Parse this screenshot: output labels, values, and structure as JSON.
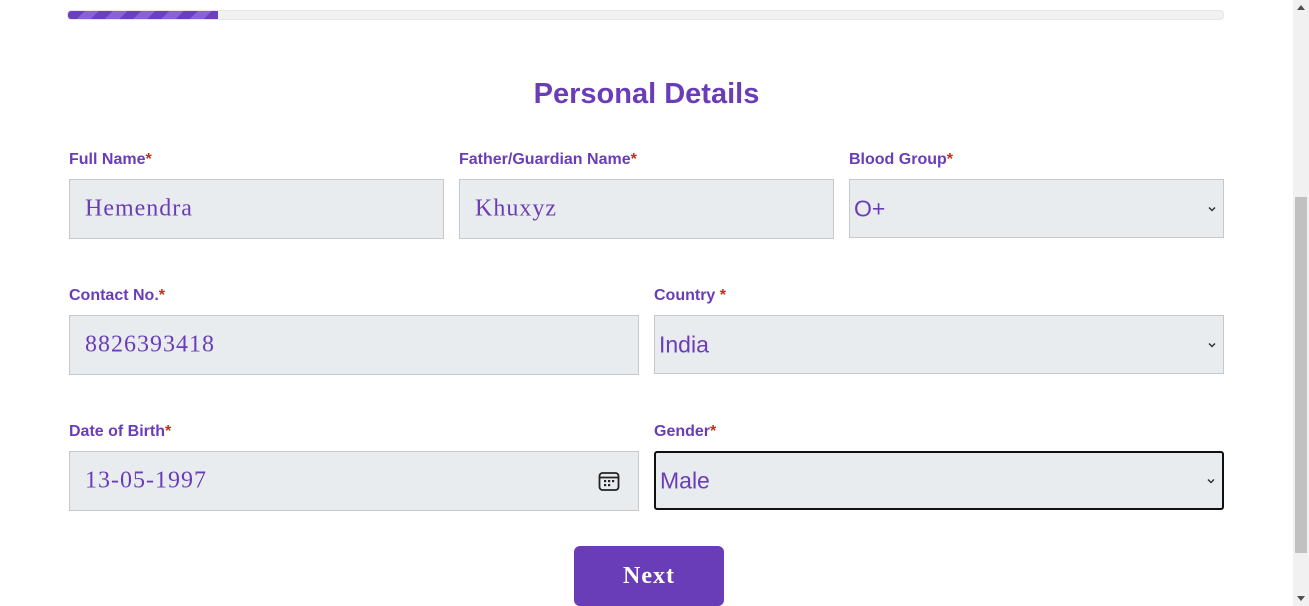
{
  "progress": {
    "value_percent": 13
  },
  "form": {
    "title": "Personal Details",
    "required_marker": "*",
    "full_name": {
      "label": "Full Name",
      "value": "Hemendra"
    },
    "guardian_name": {
      "label": "Father/Guardian Name",
      "value": "Khuxyz"
    },
    "blood_group": {
      "label": "Blood Group",
      "value": "O+"
    },
    "contact": {
      "label": "Contact No.",
      "value": "8826393418"
    },
    "country": {
      "label": "Country ",
      "value": "India"
    },
    "dob": {
      "label": "Date of Birth",
      "value": "13-05-1997"
    },
    "gender": {
      "label": "Gender",
      "value": "Male"
    },
    "next_label": "Next"
  },
  "icons": {
    "select_arrow": "chevron-down-icon",
    "date_picker": "calendar-icon"
  },
  "colors": {
    "accent": "#6a3db8",
    "required": "#e11d1d",
    "field_bg": "#e9ecef"
  }
}
